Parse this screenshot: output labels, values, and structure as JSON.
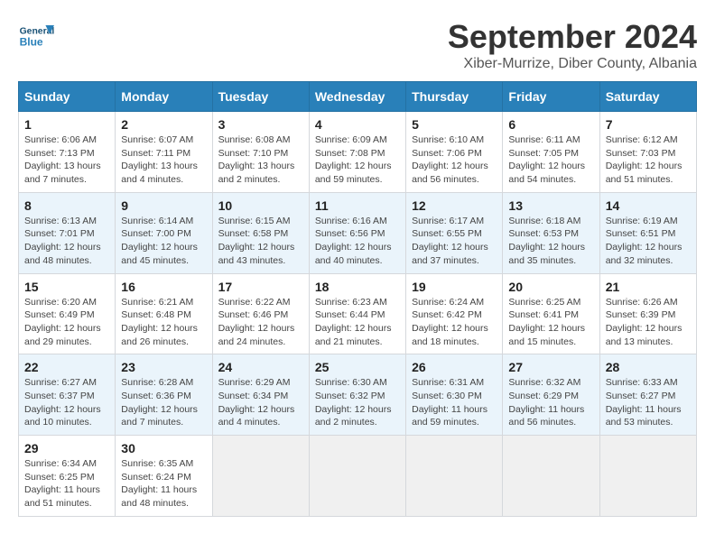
{
  "header": {
    "logo_general": "General",
    "logo_blue": "Blue",
    "month_title": "September 2024",
    "subtitle": "Xiber-Murrize, Diber County, Albania"
  },
  "weekdays": [
    "Sunday",
    "Monday",
    "Tuesday",
    "Wednesday",
    "Thursday",
    "Friday",
    "Saturday"
  ],
  "days": [
    {
      "day": "",
      "info": ""
    },
    {
      "day": "",
      "info": ""
    },
    {
      "day": "",
      "info": ""
    },
    {
      "day": "",
      "info": ""
    },
    {
      "day": "",
      "info": ""
    },
    {
      "day": "",
      "info": ""
    },
    {
      "day": "",
      "info": ""
    },
    {
      "day": "1",
      "sunrise": "6:06 AM",
      "sunset": "7:13 PM",
      "daylight": "13 hours and 7 minutes."
    },
    {
      "day": "2",
      "sunrise": "6:07 AM",
      "sunset": "7:11 PM",
      "daylight": "13 hours and 4 minutes."
    },
    {
      "day": "3",
      "sunrise": "6:08 AM",
      "sunset": "7:10 PM",
      "daylight": "13 hours and 2 minutes."
    },
    {
      "day": "4",
      "sunrise": "6:09 AM",
      "sunset": "7:08 PM",
      "daylight": "12 hours and 59 minutes."
    },
    {
      "day": "5",
      "sunrise": "6:10 AM",
      "sunset": "7:06 PM",
      "daylight": "12 hours and 56 minutes."
    },
    {
      "day": "6",
      "sunrise": "6:11 AM",
      "sunset": "7:05 PM",
      "daylight": "12 hours and 54 minutes."
    },
    {
      "day": "7",
      "sunrise": "6:12 AM",
      "sunset": "7:03 PM",
      "daylight": "12 hours and 51 minutes."
    },
    {
      "day": "8",
      "sunrise": "6:13 AM",
      "sunset": "7:01 PM",
      "daylight": "12 hours and 48 minutes."
    },
    {
      "day": "9",
      "sunrise": "6:14 AM",
      "sunset": "7:00 PM",
      "daylight": "12 hours and 45 minutes."
    },
    {
      "day": "10",
      "sunrise": "6:15 AM",
      "sunset": "6:58 PM",
      "daylight": "12 hours and 43 minutes."
    },
    {
      "day": "11",
      "sunrise": "6:16 AM",
      "sunset": "6:56 PM",
      "daylight": "12 hours and 40 minutes."
    },
    {
      "day": "12",
      "sunrise": "6:17 AM",
      "sunset": "6:55 PM",
      "daylight": "12 hours and 37 minutes."
    },
    {
      "day": "13",
      "sunrise": "6:18 AM",
      "sunset": "6:53 PM",
      "daylight": "12 hours and 35 minutes."
    },
    {
      "day": "14",
      "sunrise": "6:19 AM",
      "sunset": "6:51 PM",
      "daylight": "12 hours and 32 minutes."
    },
    {
      "day": "15",
      "sunrise": "6:20 AM",
      "sunset": "6:49 PM",
      "daylight": "12 hours and 29 minutes."
    },
    {
      "day": "16",
      "sunrise": "6:21 AM",
      "sunset": "6:48 PM",
      "daylight": "12 hours and 26 minutes."
    },
    {
      "day": "17",
      "sunrise": "6:22 AM",
      "sunset": "6:46 PM",
      "daylight": "12 hours and 24 minutes."
    },
    {
      "day": "18",
      "sunrise": "6:23 AM",
      "sunset": "6:44 PM",
      "daylight": "12 hours and 21 minutes."
    },
    {
      "day": "19",
      "sunrise": "6:24 AM",
      "sunset": "6:42 PM",
      "daylight": "12 hours and 18 minutes."
    },
    {
      "day": "20",
      "sunrise": "6:25 AM",
      "sunset": "6:41 PM",
      "daylight": "12 hours and 15 minutes."
    },
    {
      "day": "21",
      "sunrise": "6:26 AM",
      "sunset": "6:39 PM",
      "daylight": "12 hours and 13 minutes."
    },
    {
      "day": "22",
      "sunrise": "6:27 AM",
      "sunset": "6:37 PM",
      "daylight": "12 hours and 10 minutes."
    },
    {
      "day": "23",
      "sunrise": "6:28 AM",
      "sunset": "6:36 PM",
      "daylight": "12 hours and 7 minutes."
    },
    {
      "day": "24",
      "sunrise": "6:29 AM",
      "sunset": "6:34 PM",
      "daylight": "12 hours and 4 minutes."
    },
    {
      "day": "25",
      "sunrise": "6:30 AM",
      "sunset": "6:32 PM",
      "daylight": "12 hours and 2 minutes."
    },
    {
      "day": "26",
      "sunrise": "6:31 AM",
      "sunset": "6:30 PM",
      "daylight": "11 hours and 59 minutes."
    },
    {
      "day": "27",
      "sunrise": "6:32 AM",
      "sunset": "6:29 PM",
      "daylight": "11 hours and 56 minutes."
    },
    {
      "day": "28",
      "sunrise": "6:33 AM",
      "sunset": "6:27 PM",
      "daylight": "11 hours and 53 minutes."
    },
    {
      "day": "29",
      "sunrise": "6:34 AM",
      "sunset": "6:25 PM",
      "daylight": "11 hours and 51 minutes."
    },
    {
      "day": "30",
      "sunrise": "6:35 AM",
      "sunset": "6:24 PM",
      "daylight": "11 hours and 48 minutes."
    },
    {
      "day": "",
      "info": ""
    },
    {
      "day": "",
      "info": ""
    },
    {
      "day": "",
      "info": ""
    },
    {
      "day": "",
      "info": ""
    },
    {
      "day": "",
      "info": ""
    }
  ]
}
